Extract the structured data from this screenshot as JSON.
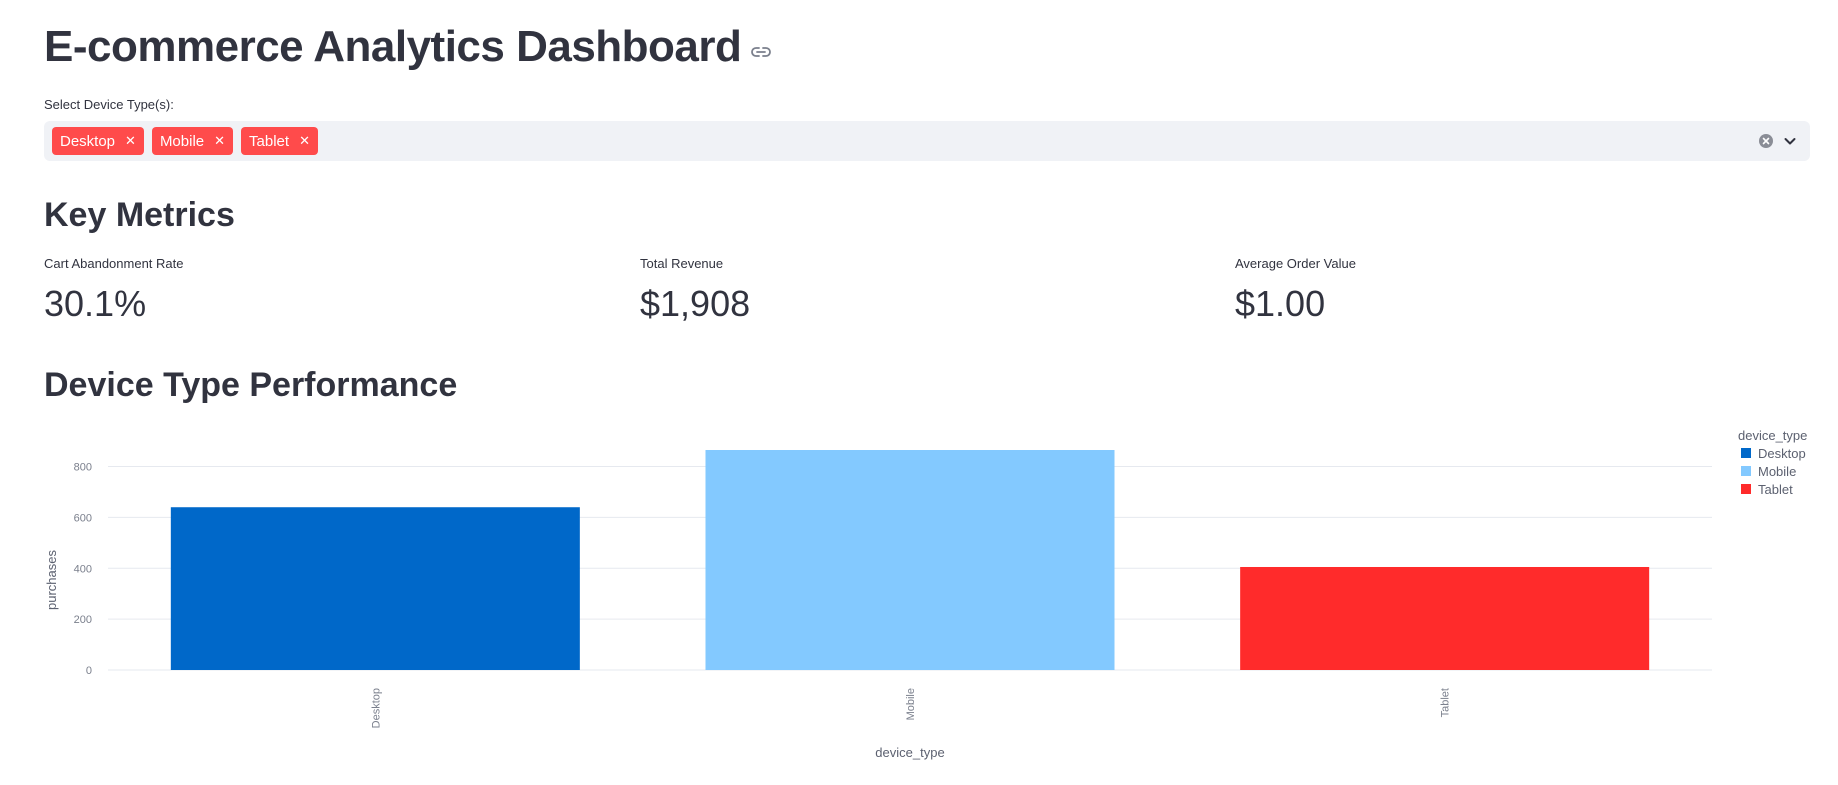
{
  "header": {
    "title": "E-commerce Analytics Dashboard"
  },
  "filter": {
    "label": "Select Device Type(s):",
    "selected": [
      "Desktop",
      "Mobile",
      "Tablet"
    ],
    "chip_color": "#ff4b4b"
  },
  "metrics": {
    "heading": "Key Metrics",
    "items": [
      {
        "label": "Cart Abandonment Rate",
        "value": "30.1%"
      },
      {
        "label": "Total Revenue",
        "value": "$1,908"
      },
      {
        "label": "Average Order Value",
        "value": "$1.00"
      }
    ]
  },
  "performance": {
    "heading": "Device Type Performance"
  },
  "chart_data": {
    "type": "bar",
    "categories": [
      "Desktop",
      "Mobile",
      "Tablet"
    ],
    "values": [
      640,
      865,
      405
    ],
    "colors": [
      "#0068c9",
      "#83c9ff",
      "#ff2b2b"
    ],
    "xlabel": "device_type",
    "ylabel": "purchases",
    "yticks": [
      0,
      200,
      400,
      600,
      800
    ],
    "ylim": [
      0,
      865
    ],
    "grid": true,
    "legend": {
      "title": "device_type",
      "position": "top-right",
      "entries": [
        "Desktop",
        "Mobile",
        "Tablet"
      ]
    }
  }
}
